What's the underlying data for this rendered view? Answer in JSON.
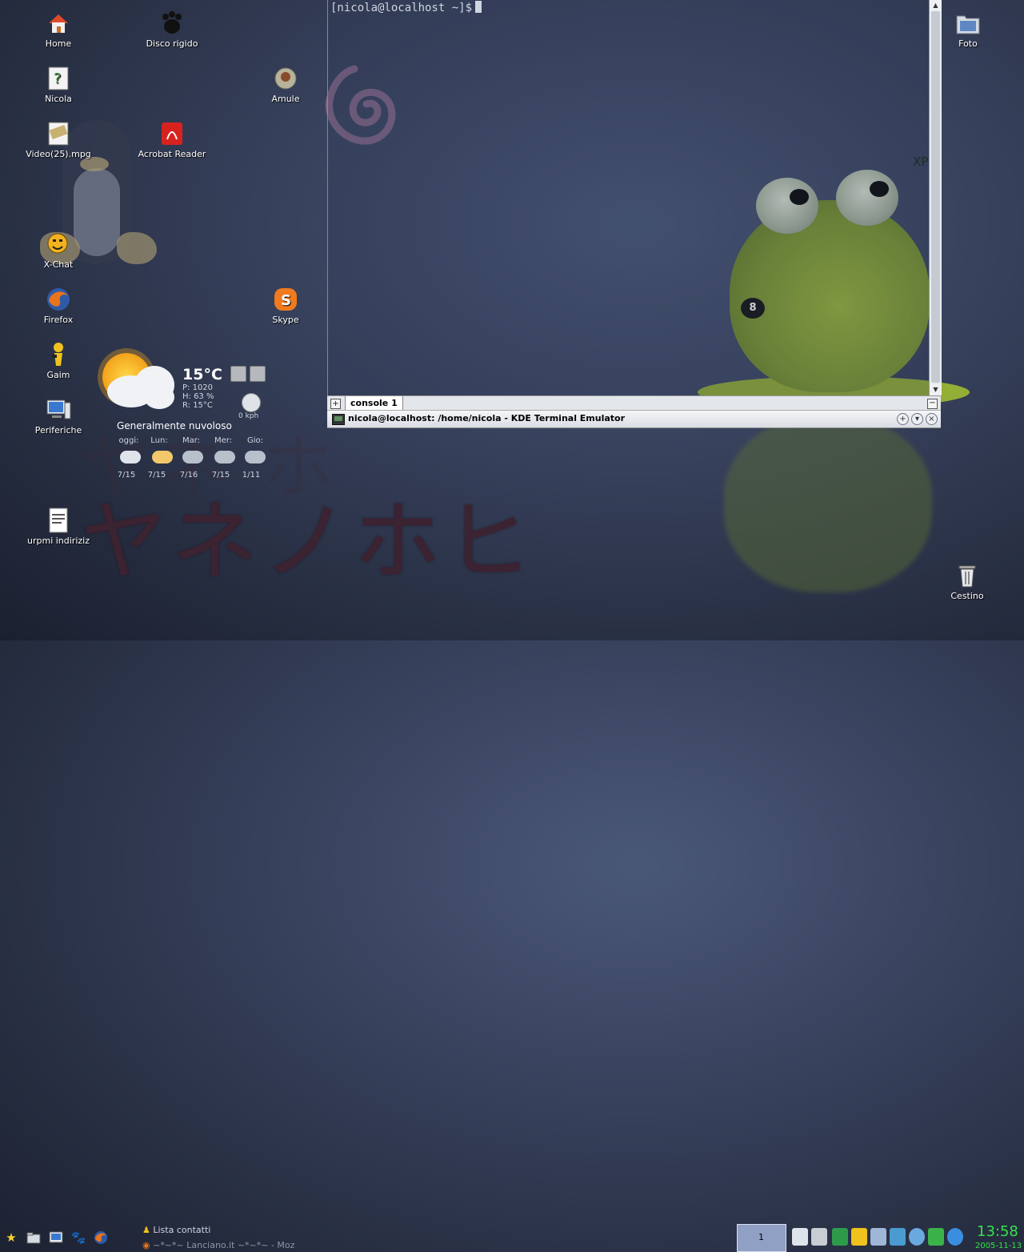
{
  "desktop": {
    "icons": [
      {
        "id": "home",
        "label": "Home",
        "icon": "home-icon"
      },
      {
        "id": "disco",
        "label": "Disco rigido",
        "icon": "hard-disk-icon"
      },
      {
        "id": "nicola",
        "label": "Nicola",
        "icon": "user-folder-icon"
      },
      {
        "id": "amule",
        "label": "Amule",
        "icon": "amule-icon"
      },
      {
        "id": "video",
        "label": "Video(25).mpg",
        "icon": "video-file-icon"
      },
      {
        "id": "acrobat",
        "label": "Acrobat Reader",
        "icon": "acrobat-reader-icon"
      },
      {
        "id": "xchat",
        "label": "X-Chat",
        "icon": "xchat-icon"
      },
      {
        "id": "firefox",
        "label": "Firefox",
        "icon": "firefox-icon"
      },
      {
        "id": "skype",
        "label": "Skype",
        "icon": "skype-icon"
      },
      {
        "id": "gaim",
        "label": "Gaim",
        "icon": "gaim-icon"
      },
      {
        "id": "periferiche",
        "label": "Periferiche",
        "icon": "devices-icon"
      },
      {
        "id": "urpmi",
        "label": "urpmi indiriziz",
        "icon": "text-file-icon"
      },
      {
        "id": "foto",
        "label": "Foto",
        "icon": "photo-folder-icon"
      },
      {
        "id": "cestino",
        "label": "Cestino",
        "icon": "trash-icon"
      }
    ],
    "wallpaper_text": "ヤネノホヒ",
    "wallpaper_badge": "XP",
    "frog_ball": "8"
  },
  "terminal": {
    "prompt": "[nicola@localhost ~]$",
    "tab_label": "console 1",
    "window_title": "nicola@localhost: /home/nicola - KDE Terminal Emulator",
    "new_tab_symbol": "+",
    "close_tab_symbol": "−"
  },
  "weather": {
    "temperature": "15°C",
    "pressure": "P: 1020",
    "humidity": "H: 63 %",
    "real_feel": "R: 15°C",
    "wind": "0 kph",
    "description": "Generalmente nuvoloso",
    "forecast": [
      {
        "day": "oggi:",
        "temps": "7/15",
        "icon": "cloudy-icon"
      },
      {
        "day": "Lun:",
        "temps": "7/15",
        "icon": "partly-sunny-icon"
      },
      {
        "day": "Mar:",
        "temps": "7/16",
        "icon": "rain-icon"
      },
      {
        "day": "Mer:",
        "temps": "7/15",
        "icon": "rain-icon"
      },
      {
        "day": "Gio:",
        "temps": "1/11",
        "icon": "rain-icon"
      }
    ]
  },
  "taskbar": {
    "tasks": [
      {
        "label": "Lista contatti",
        "icon": "gaim-icon"
      },
      {
        "label": "~*~*~ Lanciano.it ~*~*~ - Moz",
        "icon": "firefox-icon"
      }
    ],
    "pager_desktop": "1",
    "clock": "13:58",
    "date": "2005-11-13"
  },
  "colors": {
    "clock": "#36e24c",
    "desktop_bg": "#37415c",
    "frog": "#8aa634"
  }
}
